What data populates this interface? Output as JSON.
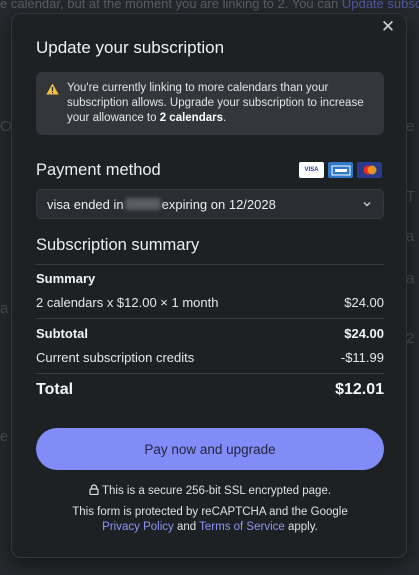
{
  "background": {
    "top_text": "e calendar, but at the moment you are linking to 2. You can ",
    "top_link": "Update subscr",
    "fragments": [
      "O",
      "e",
      "T",
      "a",
      "a",
      "2",
      "a",
      "e"
    ]
  },
  "modal": {
    "title": "Update your subscription",
    "close_label": "✕",
    "alert": {
      "text_before": "You're currently linking to more calendars than your subscription allows. Upgrade your subscription to increase your allowance to ",
      "text_bold": "2 calendars",
      "text_after": "."
    },
    "payment": {
      "heading": "Payment method",
      "card_brands": [
        "VISA",
        "AMEX",
        "mastercard"
      ],
      "card_prefix": "visa ended in",
      "card_suffix": "expiring on 12/2028"
    },
    "summary": {
      "heading": "Subscription summary",
      "subheading": "Summary",
      "line_item": "2 calendars x $12.00 × 1 month",
      "line_amount": "$24.00",
      "subtotal_label": "Subtotal",
      "subtotal_amount": "$24.00",
      "credits_label": "Current subscription credits",
      "credits_amount": "-$11.99",
      "total_label": "Total",
      "total_amount": "$12.01"
    },
    "pay_button": "Pay now and upgrade",
    "secure_text": "This is a secure 256-bit SSL encrypted page.",
    "recaptcha": {
      "before": "This form is protected by reCAPTCHA and the Google",
      "privacy": "Privacy Policy",
      "and": "and",
      "terms": "Terms of Service",
      "after": "apply."
    }
  },
  "colors": {
    "accent": "#818cf8",
    "modal_bg": "#1e2124",
    "page_bg": "#26292d"
  }
}
